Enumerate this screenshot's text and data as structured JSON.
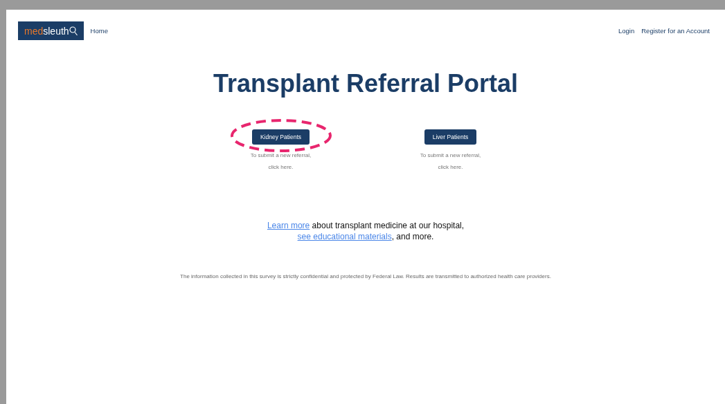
{
  "nav": {
    "logo": {
      "prefix": "med",
      "name": "sleuth"
    },
    "home": "Home",
    "links": [
      "Login",
      "Register for an Account"
    ]
  },
  "title": "Transplant Referral Portal",
  "options": [
    {
      "button": "Kidney Patients",
      "lines": [
        "To submit a new referral,",
        "click here."
      ],
      "highlighted": true
    },
    {
      "button": "Liver Patients",
      "lines": [
        "To submit a new referral,",
        "click here."
      ],
      "highlighted": false
    }
  ],
  "info": [
    {
      "kind": "link",
      "text": "Learn more"
    },
    {
      "kind": "text",
      "text": " about transplant medicine at our hospital, "
    },
    {
      "kind": "link",
      "text": "see educational materials"
    },
    {
      "kind": "text",
      "text": ", and more."
    }
  ],
  "footer": "The information collected in this survey is strictly confidential and protected by Federal Law. Results are transmitted to authorized health care providers."
}
